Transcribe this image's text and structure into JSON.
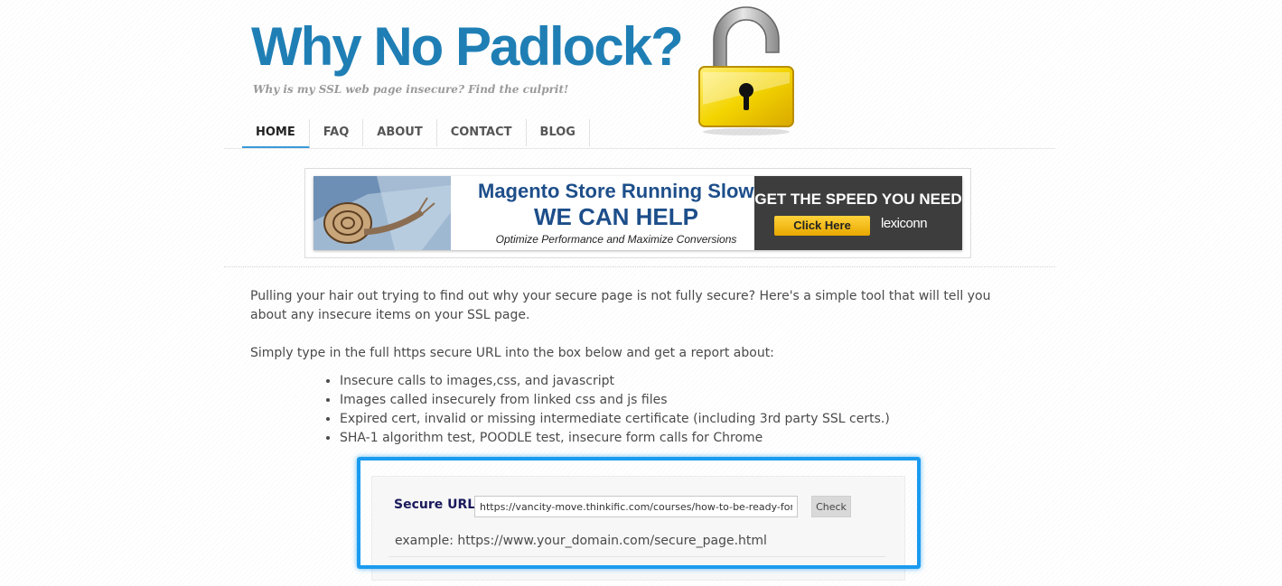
{
  "header": {
    "site_title": "Why No Padlock?",
    "tagline": "Why is my SSL web page insecure? Find the culprit!",
    "logo_icon": "padlock-icon"
  },
  "nav": {
    "items": [
      {
        "label": "HOME",
        "active": true
      },
      {
        "label": "FAQ",
        "active": false
      },
      {
        "label": "ABOUT",
        "active": false
      },
      {
        "label": "CONTACT",
        "active": false
      },
      {
        "label": "BLOG",
        "active": false
      }
    ]
  },
  "banner": {
    "line1": "Magento Store Running Slow?",
    "line2": "WE CAN HELP",
    "line3": "Optimize Performance and Maximize Conversions",
    "cta_title": "GET THE SPEED YOU NEED",
    "cta_button": "Click Here",
    "brand": "lexiconn"
  },
  "content": {
    "intro": "Pulling your hair out trying to find out why your secure page is not fully secure? Here's a simple tool that will tell you about any insecure items on your SSL page.",
    "intro2": "Simply type in the full https secure URL into the box below and get a report about:",
    "features": [
      "Insecure calls to images,css, and javascript",
      "Images called insecurely from linked css and js files",
      "Expired cert, invalid or missing intermediate certificate (including 3rd party SSL certs.)",
      "SHA-1 algorithm test, POODLE test, insecure form calls for Chrome"
    ]
  },
  "checker": {
    "label": "Secure URL:",
    "url_value": "https://vancity-move.thinkific.com/courses/how-to-be-ready-for-moving-day",
    "check_button": "Check",
    "example": "example: https://www.your_domain.com/secure_page.html"
  },
  "colors": {
    "title_blue": "#1f7fb5",
    "nav_active_underline": "#3a9ad9",
    "highlight_blue": "#1a9bef",
    "banner_navy": "#1d4e8a",
    "cta_yellow": "#ffd23a"
  }
}
